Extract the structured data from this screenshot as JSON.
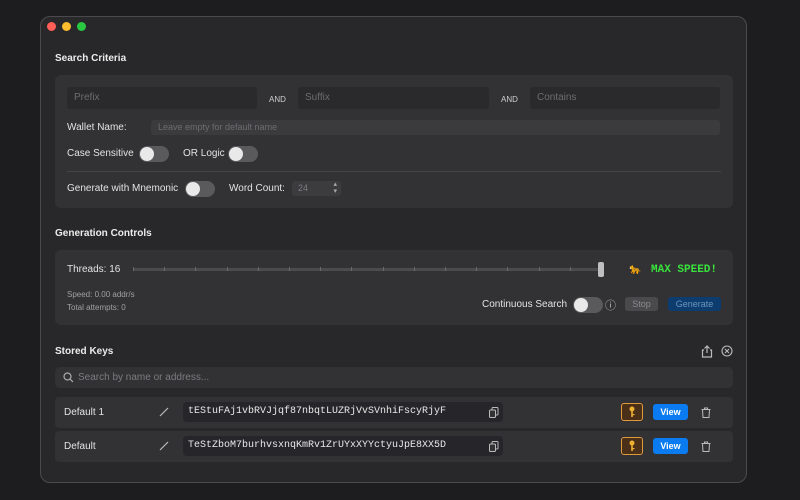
{
  "search_criteria": {
    "title": "Search Criteria",
    "prefix_placeholder": "Prefix",
    "and1": "AND",
    "suffix_placeholder": "Suffix",
    "and2": "AND",
    "contains_placeholder": "Contains",
    "wallet_name_label": "Wallet Name:",
    "wallet_name_placeholder": "Leave empty for default name",
    "case_sensitive_label": "Case Sensitive",
    "or_logic_label": "OR Logic",
    "mnemonic_label": "Generate with Mnemonic",
    "word_count_label": "Word Count:",
    "word_count_value": "24"
  },
  "generation": {
    "title": "Generation Controls",
    "threads_label": "Threads: 16",
    "speed_badge_icon": "🐆",
    "speed_badge_text": "MAX SPEED!",
    "speed_text": "Speed: 0.00 addr/s",
    "attempts_text": "Total attempts: 0",
    "continuous_label": "Continuous Search",
    "info_icon": "ⓘ",
    "stop_label": "Stop",
    "generate_label": "Generate",
    "threads_level": 1.0
  },
  "stored_keys": {
    "title": "Stored Keys",
    "search_placeholder": "Search by name or address...",
    "rows": [
      {
        "name": "Default 1",
        "address": "tEStuFAj1vbRVJjqf87nbqtLUZRjVvSVnhiFscyRjyF",
        "view_label": "View"
      },
      {
        "name": "Default",
        "address": "TeStZboM7burhvsxnqKmRv1ZrUYxXYYctyuJpE8XX5D",
        "view_label": "View"
      }
    ]
  },
  "colors": {
    "accent_blue": "#0a7bf0",
    "speed_green": "#38e33d",
    "key_orange": "#e09a3a"
  }
}
